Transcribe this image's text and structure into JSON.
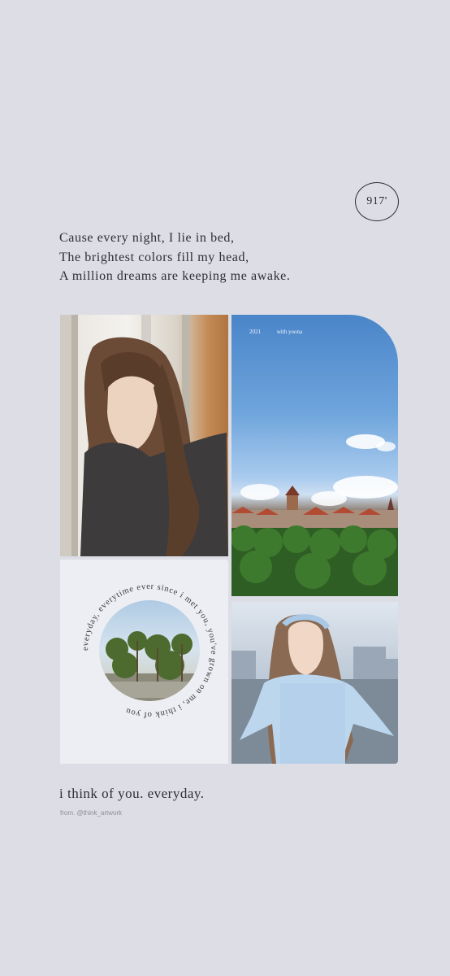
{
  "badge": {
    "text": "917'"
  },
  "lyrics": [
    "Cause every night, I lie in bed,",
    "The brightest colors fill my head,",
    "A million dreams are keeping me awake."
  ],
  "photo_panel": {
    "year": "2021",
    "subtitle": "with yoona"
  },
  "circle_text": "everyday, everytime  ever since i met you, you've grown on me, i think of you",
  "caption": {
    "title": "i think of you. everyday.",
    "credit": "from. @think_artwork"
  }
}
